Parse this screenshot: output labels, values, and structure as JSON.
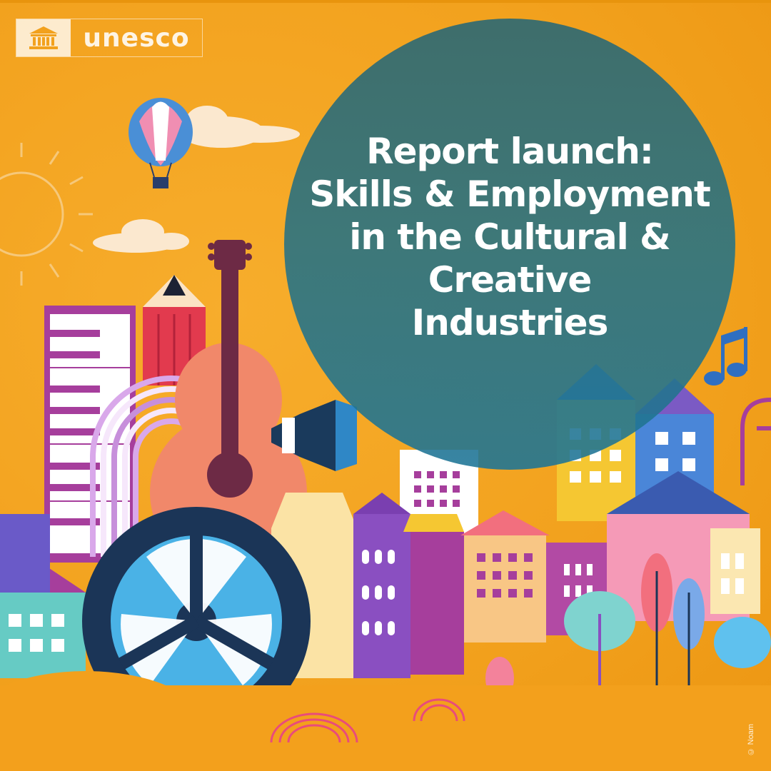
{
  "logo": {
    "brand_text": "unesco",
    "emblem_icon": "unesco-temple-icon"
  },
  "headline": {
    "lines": [
      "Report launch:",
      "Skills & Employment",
      "in the Cultural &",
      "Creative",
      "Industries"
    ]
  },
  "credit": {
    "text": "© Noam"
  },
  "colors": {
    "background": "#f2a11d",
    "circle": "#2e7480",
    "text": "#ffffff"
  }
}
